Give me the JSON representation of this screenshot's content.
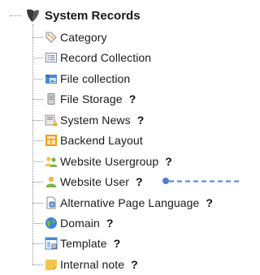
{
  "root": {
    "label": "System Records",
    "icon": "typo3-logo-icon"
  },
  "help_mark": "?",
  "items": [
    {
      "label": "Category",
      "icon": "category-tag-icon",
      "help": false
    },
    {
      "label": "Record Collection",
      "icon": "record-collection-icon",
      "help": false
    },
    {
      "label": "File collection",
      "icon": "file-collection-icon",
      "help": false
    },
    {
      "label": "File Storage",
      "icon": "file-storage-icon",
      "help": true
    },
    {
      "label": "System News",
      "icon": "system-news-icon",
      "help": true
    },
    {
      "label": "Backend Layout",
      "icon": "backend-layout-icon",
      "help": false
    },
    {
      "label": "Website Usergroup",
      "icon": "website-usergroup-icon",
      "help": true
    },
    {
      "label": "Website User",
      "icon": "website-user-icon",
      "help": true
    },
    {
      "label": "Alternative Page Language",
      "icon": "page-language-icon",
      "help": true
    },
    {
      "label": "Domain",
      "icon": "domain-globe-icon",
      "help": true
    },
    {
      "label": "Template",
      "icon": "template-icon",
      "help": true
    },
    {
      "label": "Internal note",
      "icon": "internal-note-icon",
      "help": true
    }
  ],
  "colors": {
    "connector": "#4f7fc9",
    "guide": "#8a8a8a"
  }
}
